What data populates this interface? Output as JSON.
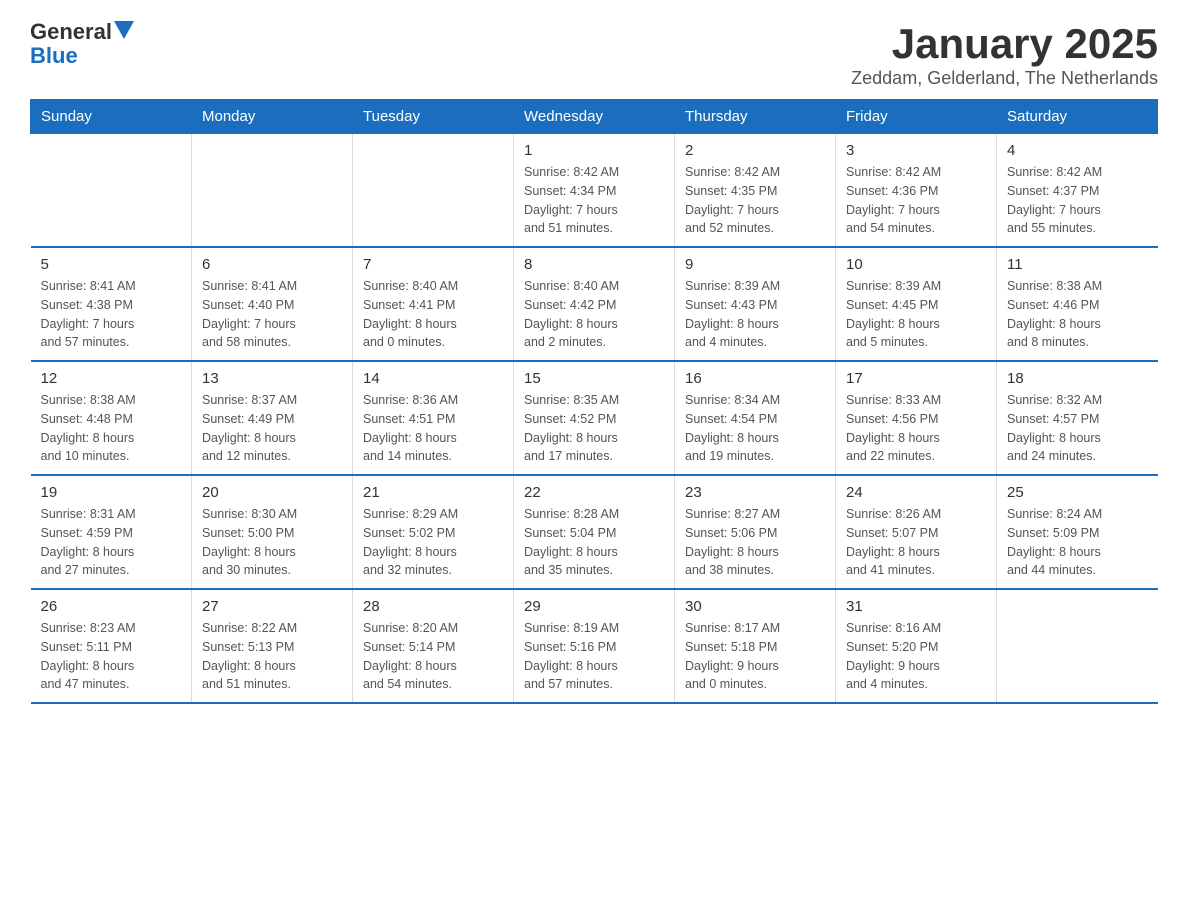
{
  "header": {
    "logo": {
      "general": "General",
      "blue": "Blue"
    },
    "title": "January 2025",
    "subtitle": "Zeddam, Gelderland, The Netherlands"
  },
  "days_of_week": [
    "Sunday",
    "Monday",
    "Tuesday",
    "Wednesday",
    "Thursday",
    "Friday",
    "Saturday"
  ],
  "weeks": [
    [
      {
        "day": "",
        "info": ""
      },
      {
        "day": "",
        "info": ""
      },
      {
        "day": "",
        "info": ""
      },
      {
        "day": "1",
        "info": "Sunrise: 8:42 AM\nSunset: 4:34 PM\nDaylight: 7 hours\nand 51 minutes."
      },
      {
        "day": "2",
        "info": "Sunrise: 8:42 AM\nSunset: 4:35 PM\nDaylight: 7 hours\nand 52 minutes."
      },
      {
        "day": "3",
        "info": "Sunrise: 8:42 AM\nSunset: 4:36 PM\nDaylight: 7 hours\nand 54 minutes."
      },
      {
        "day": "4",
        "info": "Sunrise: 8:42 AM\nSunset: 4:37 PM\nDaylight: 7 hours\nand 55 minutes."
      }
    ],
    [
      {
        "day": "5",
        "info": "Sunrise: 8:41 AM\nSunset: 4:38 PM\nDaylight: 7 hours\nand 57 minutes."
      },
      {
        "day": "6",
        "info": "Sunrise: 8:41 AM\nSunset: 4:40 PM\nDaylight: 7 hours\nand 58 minutes."
      },
      {
        "day": "7",
        "info": "Sunrise: 8:40 AM\nSunset: 4:41 PM\nDaylight: 8 hours\nand 0 minutes."
      },
      {
        "day": "8",
        "info": "Sunrise: 8:40 AM\nSunset: 4:42 PM\nDaylight: 8 hours\nand 2 minutes."
      },
      {
        "day": "9",
        "info": "Sunrise: 8:39 AM\nSunset: 4:43 PM\nDaylight: 8 hours\nand 4 minutes."
      },
      {
        "day": "10",
        "info": "Sunrise: 8:39 AM\nSunset: 4:45 PM\nDaylight: 8 hours\nand 5 minutes."
      },
      {
        "day": "11",
        "info": "Sunrise: 8:38 AM\nSunset: 4:46 PM\nDaylight: 8 hours\nand 8 minutes."
      }
    ],
    [
      {
        "day": "12",
        "info": "Sunrise: 8:38 AM\nSunset: 4:48 PM\nDaylight: 8 hours\nand 10 minutes."
      },
      {
        "day": "13",
        "info": "Sunrise: 8:37 AM\nSunset: 4:49 PM\nDaylight: 8 hours\nand 12 minutes."
      },
      {
        "day": "14",
        "info": "Sunrise: 8:36 AM\nSunset: 4:51 PM\nDaylight: 8 hours\nand 14 minutes."
      },
      {
        "day": "15",
        "info": "Sunrise: 8:35 AM\nSunset: 4:52 PM\nDaylight: 8 hours\nand 17 minutes."
      },
      {
        "day": "16",
        "info": "Sunrise: 8:34 AM\nSunset: 4:54 PM\nDaylight: 8 hours\nand 19 minutes."
      },
      {
        "day": "17",
        "info": "Sunrise: 8:33 AM\nSunset: 4:56 PM\nDaylight: 8 hours\nand 22 minutes."
      },
      {
        "day": "18",
        "info": "Sunrise: 8:32 AM\nSunset: 4:57 PM\nDaylight: 8 hours\nand 24 minutes."
      }
    ],
    [
      {
        "day": "19",
        "info": "Sunrise: 8:31 AM\nSunset: 4:59 PM\nDaylight: 8 hours\nand 27 minutes."
      },
      {
        "day": "20",
        "info": "Sunrise: 8:30 AM\nSunset: 5:00 PM\nDaylight: 8 hours\nand 30 minutes."
      },
      {
        "day": "21",
        "info": "Sunrise: 8:29 AM\nSunset: 5:02 PM\nDaylight: 8 hours\nand 32 minutes."
      },
      {
        "day": "22",
        "info": "Sunrise: 8:28 AM\nSunset: 5:04 PM\nDaylight: 8 hours\nand 35 minutes."
      },
      {
        "day": "23",
        "info": "Sunrise: 8:27 AM\nSunset: 5:06 PM\nDaylight: 8 hours\nand 38 minutes."
      },
      {
        "day": "24",
        "info": "Sunrise: 8:26 AM\nSunset: 5:07 PM\nDaylight: 8 hours\nand 41 minutes."
      },
      {
        "day": "25",
        "info": "Sunrise: 8:24 AM\nSunset: 5:09 PM\nDaylight: 8 hours\nand 44 minutes."
      }
    ],
    [
      {
        "day": "26",
        "info": "Sunrise: 8:23 AM\nSunset: 5:11 PM\nDaylight: 8 hours\nand 47 minutes."
      },
      {
        "day": "27",
        "info": "Sunrise: 8:22 AM\nSunset: 5:13 PM\nDaylight: 8 hours\nand 51 minutes."
      },
      {
        "day": "28",
        "info": "Sunrise: 8:20 AM\nSunset: 5:14 PM\nDaylight: 8 hours\nand 54 minutes."
      },
      {
        "day": "29",
        "info": "Sunrise: 8:19 AM\nSunset: 5:16 PM\nDaylight: 8 hours\nand 57 minutes."
      },
      {
        "day": "30",
        "info": "Sunrise: 8:17 AM\nSunset: 5:18 PM\nDaylight: 9 hours\nand 0 minutes."
      },
      {
        "day": "31",
        "info": "Sunrise: 8:16 AM\nSunset: 5:20 PM\nDaylight: 9 hours\nand 4 minutes."
      },
      {
        "day": "",
        "info": ""
      }
    ]
  ]
}
